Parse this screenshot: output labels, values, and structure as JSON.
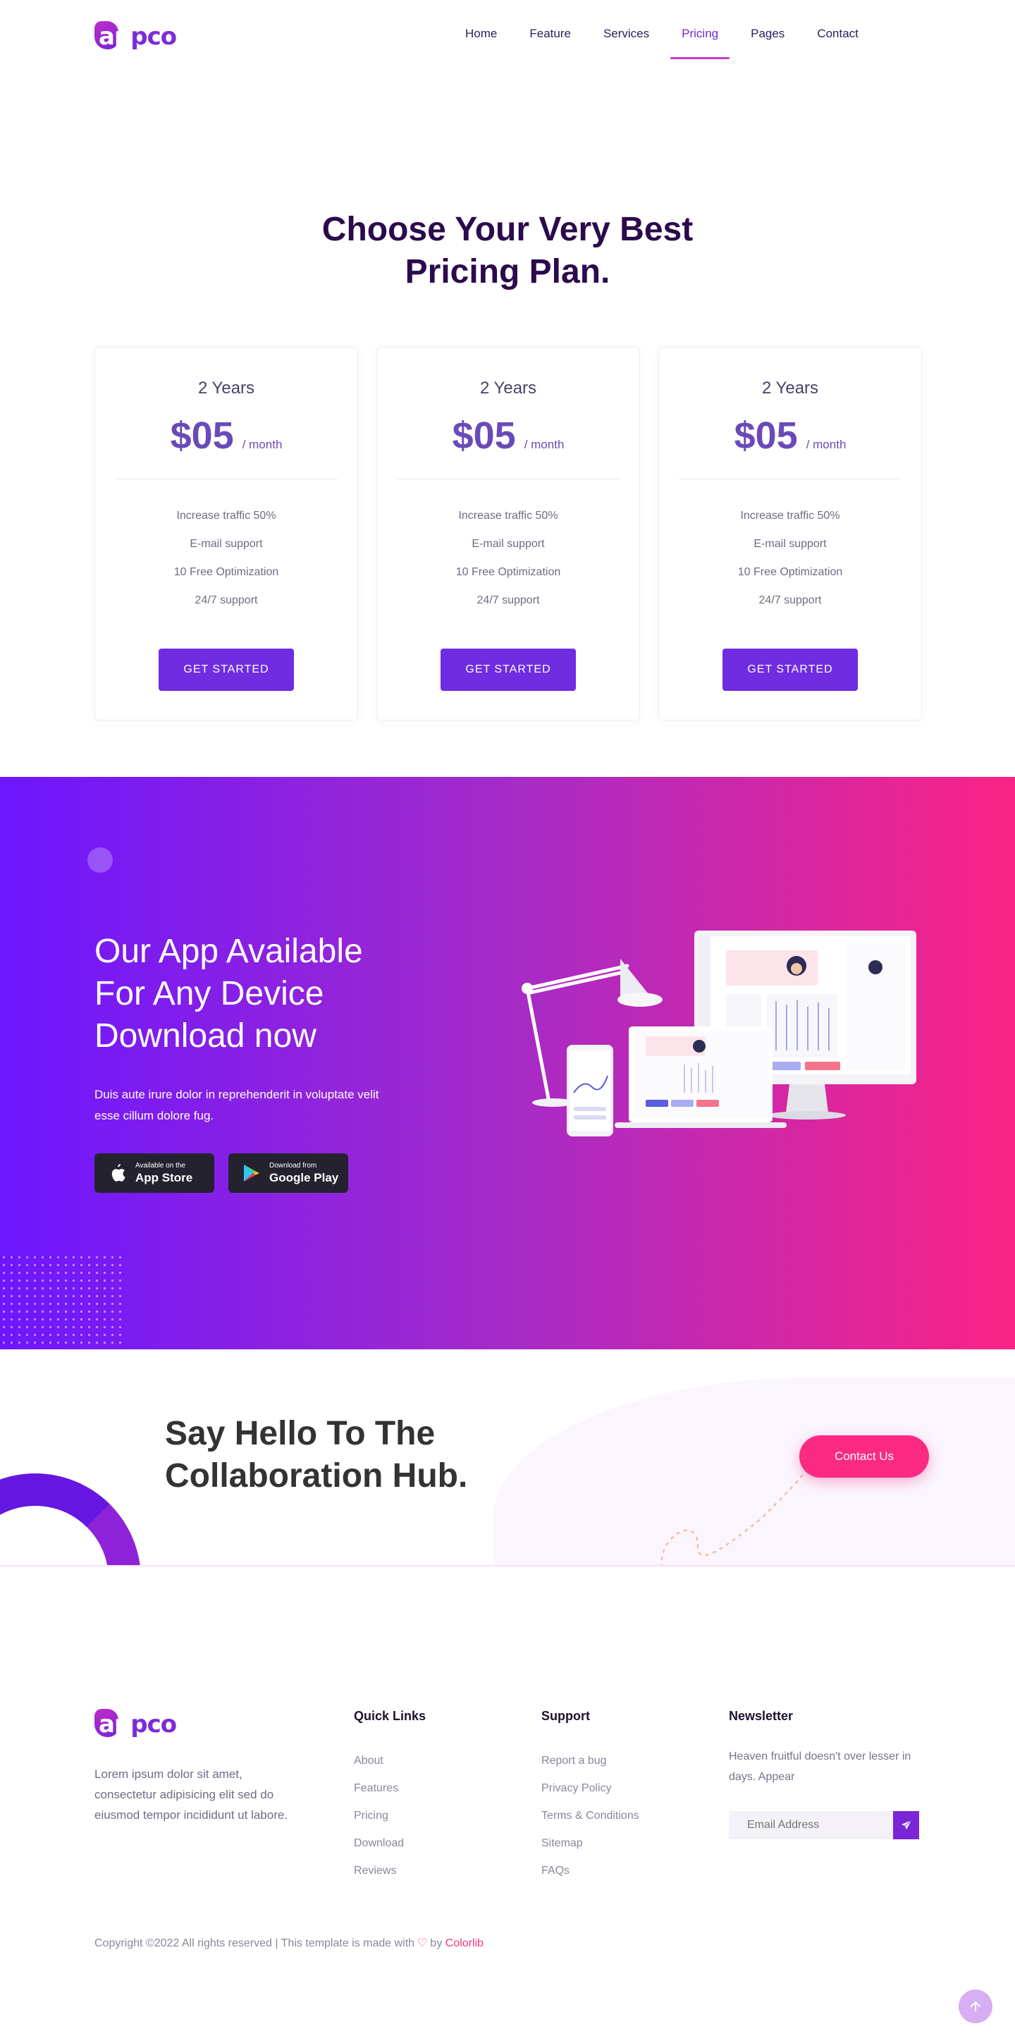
{
  "header": {
    "logo_text": "appco",
    "nav": [
      {
        "label": "Home"
      },
      {
        "label": "Feature"
      },
      {
        "label": "Services"
      },
      {
        "label": "Pricing",
        "active": true
      },
      {
        "label": "Pages"
      },
      {
        "label": "Contact"
      }
    ]
  },
  "pricing": {
    "title_line1": "Choose Your Very Best",
    "title_line2": "Pricing Plan.",
    "plans": [
      {
        "period": "2 Years",
        "price": "$05",
        "per": "/ month",
        "features": [
          "Increase traffic 50%",
          "E-mail support",
          "10 Free Optimization",
          "24/7 support"
        ],
        "button": "GET STARTED"
      },
      {
        "period": "2 Years",
        "price": "$05",
        "per": "/ month",
        "features": [
          "Increase traffic 50%",
          "E-mail support",
          "10 Free Optimization",
          "24/7 support"
        ],
        "button": "GET STARTED"
      },
      {
        "period": "2 Years",
        "price": "$05",
        "per": "/ month",
        "features": [
          "Increase traffic 50%",
          "E-mail support",
          "10 Free Optimization",
          "24/7 support"
        ],
        "button": "GET STARTED"
      }
    ]
  },
  "app": {
    "title_line1": "Our App Available",
    "title_line2": "For Any Device",
    "title_line3": "Download now",
    "description": "Duis aute irure dolor in reprehenderit in voluptate velit esse cillum dolore fug.",
    "app_store_small": "Available on the",
    "app_store_big": "App Store",
    "google_small": "Download from",
    "google_big": "Google Play",
    "colors": {
      "start": "#6d16ff",
      "end": "#fb2385"
    }
  },
  "hello": {
    "title_line1": "Say Hello To The",
    "title_line2": "Collaboration Hub.",
    "contact_button": "Contact Us"
  },
  "footer": {
    "logo_text": "appco",
    "about": "Lorem ipsum dolor sit amet, consectetur adipisicing elit sed do eiusmod tempor incididunt ut labore.",
    "quick_links_title": "Quick Links",
    "quick_links": [
      "About",
      "Features",
      "Pricing",
      "Download",
      "Reviews"
    ],
    "support_title": "Support",
    "support_links": [
      "Report a bug",
      "Privacy Policy",
      "Terms & Conditions",
      "Sitemap",
      "FAQs"
    ],
    "newsletter_title": "Newsletter",
    "newsletter_text": "Heaven fruitful doesn't over lesser in days. Appear",
    "email_placeholder": "Email Address",
    "copyright_prefix": "Copyright ©2022 All rights reserved | This template is made with",
    "copyright_by": "by",
    "copyright_brand": "Colorlib"
  }
}
